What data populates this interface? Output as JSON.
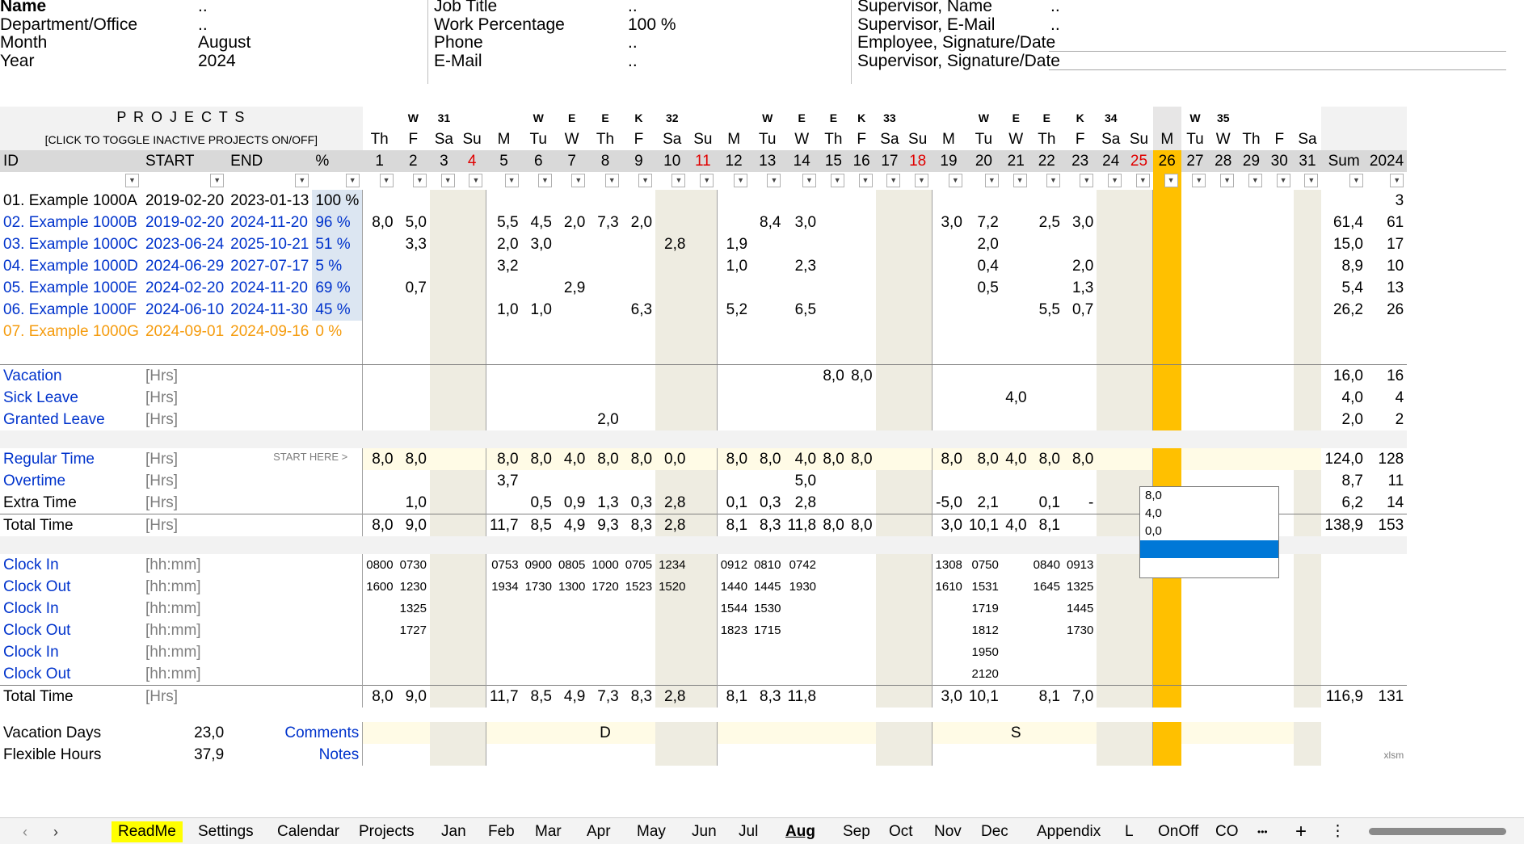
{
  "header": {
    "col1": [
      {
        "label": "Name",
        "value": ".."
      },
      {
        "label": "Department/Office",
        "value": ".."
      },
      {
        "label": "Month",
        "value": "August"
      },
      {
        "label": "Year",
        "value": "2024"
      }
    ],
    "col2": [
      {
        "label": "Job Title",
        "value": ".."
      },
      {
        "label": "Work Percentage",
        "value": "100 %"
      },
      {
        "label": "Phone",
        "value": ".."
      },
      {
        "label": "E-Mail",
        "value": ".."
      }
    ],
    "col3": [
      {
        "label": "Supervisor, Name",
        "value": ".."
      },
      {
        "label": "Supervisor, E-Mail",
        "value": ".."
      },
      {
        "label": "Employee, Signature/Date",
        "value": ""
      },
      {
        "label": "Supervisor, Signature/Date",
        "value": ""
      }
    ]
  },
  "projects_title": "P R O J E C T S",
  "projects_subtitle": "[CLICK TO TOGGLE INACTIVE PROJECTS ON/OFF]",
  "col_headers": {
    "id": "ID",
    "start": "START",
    "end": "END",
    "pct": "%",
    "sum": "Sum",
    "year": "2024"
  },
  "weeks": [
    {
      "letters": [
        "W",
        "31"
      ],
      "span": 4
    },
    {
      "letters": [
        "W",
        "E",
        "E",
        "K",
        "32"
      ],
      "span": 7
    },
    {
      "letters": [
        "W",
        "E",
        "E",
        "K",
        "33"
      ],
      "span": 7
    },
    {
      "letters": [
        "W",
        "E",
        "E",
        "K",
        "34"
      ],
      "span": 7
    },
    {
      "letters": [
        "W",
        "35"
      ],
      "span": 6
    }
  ],
  "days": [
    {
      "d": "1",
      "wd": "Th"
    },
    {
      "d": "2",
      "wd": "F"
    },
    {
      "d": "3",
      "wd": "Sa"
    },
    {
      "d": "4",
      "wd": "Su"
    },
    {
      "d": "5",
      "wd": "M"
    },
    {
      "d": "6",
      "wd": "Tu"
    },
    {
      "d": "7",
      "wd": "W"
    },
    {
      "d": "8",
      "wd": "Th"
    },
    {
      "d": "9",
      "wd": "F"
    },
    {
      "d": "10",
      "wd": "Sa"
    },
    {
      "d": "11",
      "wd": "Su"
    },
    {
      "d": "12",
      "wd": "M"
    },
    {
      "d": "13",
      "wd": "Tu"
    },
    {
      "d": "14",
      "wd": "W"
    },
    {
      "d": "15",
      "wd": "Th"
    },
    {
      "d": "16",
      "wd": "F"
    },
    {
      "d": "17",
      "wd": "Sa"
    },
    {
      "d": "18",
      "wd": "Su"
    },
    {
      "d": "19",
      "wd": "M"
    },
    {
      "d": "20",
      "wd": "Tu"
    },
    {
      "d": "21",
      "wd": "W"
    },
    {
      "d": "22",
      "wd": "Th"
    },
    {
      "d": "23",
      "wd": "F"
    },
    {
      "d": "24",
      "wd": "Sa"
    },
    {
      "d": "25",
      "wd": "Su"
    },
    {
      "d": "26",
      "wd": "M"
    },
    {
      "d": "27",
      "wd": "Tu"
    },
    {
      "d": "28",
      "wd": "W"
    },
    {
      "d": "29",
      "wd": "Th"
    },
    {
      "d": "30",
      "wd": "F"
    },
    {
      "d": "31",
      "wd": "Sa"
    }
  ],
  "projects": [
    {
      "id": "01. Example 1000A",
      "start": "2019-02-20",
      "end": "2023-01-13",
      "pct": "100 %",
      "color": "black",
      "vals": {},
      "sum": "",
      "year": "3"
    },
    {
      "id": "02. Example 1000B",
      "start": "2019-02-20",
      "end": "2024-11-20",
      "pct": "96 %",
      "color": "blue",
      "vals": {
        "1": "8,0",
        "2": "5,0",
        "5": "5,5",
        "6": "4,5",
        "7": "2,0",
        "8": "7,3",
        "9": "2,0",
        "13": "8,4",
        "14": "3,0",
        "19": "3,0",
        "20": "7,2",
        "22": "2,5",
        "23": "3,0"
      },
      "sum": "61,4",
      "year": "61"
    },
    {
      "id": "03. Example 1000C",
      "start": "2023-06-24",
      "end": "2025-10-21",
      "pct": "51 %",
      "color": "blue",
      "vals": {
        "2": "3,3",
        "5": "2,0",
        "6": "3,0",
        "10": "2,8",
        "12": "1,9",
        "20": "2,0"
      },
      "sum": "15,0",
      "year": "17"
    },
    {
      "id": "04. Example 1000D",
      "start": "2024-06-29",
      "end": "2027-07-17",
      "pct": "5 %",
      "color": "blue",
      "vals": {
        "5": "3,2",
        "12": "1,0",
        "14": "2,3",
        "20": "0,4",
        "23": "2,0"
      },
      "sum": "8,9",
      "year": "10"
    },
    {
      "id": "05. Example 1000E",
      "start": "2024-02-20",
      "end": "2024-11-20",
      "pct": "69 %",
      "color": "blue",
      "vals": {
        "2": "0,7",
        "7": "2,9",
        "20": "0,5",
        "23": "1,3"
      },
      "sum": "5,4",
      "year": "13"
    },
    {
      "id": "06. Example 1000F",
      "start": "2024-06-10",
      "end": "2024-11-30",
      "pct": "45 %",
      "color": "blue",
      "vals": {
        "5": "1,0",
        "6": "1,0",
        "9": "6,3",
        "12": "5,2",
        "14": "6,5",
        "22": "5,5",
        "23": "0,7"
      },
      "sum": "26,2",
      "year": "26"
    },
    {
      "id": "07. Example 1000G",
      "start": "2024-09-01",
      "end": "2024-09-16",
      "pct": "0 %",
      "color": "orange",
      "vals": {},
      "sum": "",
      "year": ""
    }
  ],
  "leave": [
    {
      "label": "Vacation",
      "unit": "[Hrs]",
      "vals": {
        "15": "8,0",
        "16": "8,0"
      },
      "sum": "16,0",
      "year": "16"
    },
    {
      "label": "Sick Leave",
      "unit": "[Hrs]",
      "vals": {
        "21": "4,0"
      },
      "sum": "4,0",
      "year": "4"
    },
    {
      "label": "Granted Leave",
      "unit": "[Hrs]",
      "vals": {
        "8": "2,0"
      },
      "sum": "2,0",
      "year": "2"
    }
  ],
  "start_here": "START HERE >",
  "times": [
    {
      "label": "Regular Time",
      "unit": "[Hrs]",
      "color": "blue",
      "vals": {
        "1": "8,0",
        "2": "8,0",
        "5": "8,0",
        "6": "8,0",
        "7": "4,0",
        "8": "8,0",
        "9": "8,0",
        "10": "0,0",
        "12": "8,0",
        "13": "8,0",
        "14": "4,0",
        "15": "8,0",
        "16": "8,0",
        "19": "8,0",
        "20": "8,0",
        "21": "4,0",
        "22": "8,0",
        "23": "8,0"
      },
      "sum": "124,0",
      "year": "128"
    },
    {
      "label": "Overtime",
      "unit": "[Hrs]",
      "color": "blue",
      "vals": {
        "5": "3,7",
        "14": "5,0"
      },
      "sum": "8,7",
      "year": "11"
    },
    {
      "label": "Extra Time",
      "unit": "[Hrs]",
      "color": "black",
      "vals": {
        "2": "1,0",
        "6": "0,5",
        "7": "0,9",
        "8": "1,3",
        "9": "0,3",
        "10": "2,8",
        "12": "0,1",
        "13": "0,3",
        "14": "2,8",
        "19": "-5,0",
        "20": "2,1",
        "22": "0,1",
        "23": "-"
      },
      "sum": "6,2",
      "year": "14"
    },
    {
      "label": "Total Time",
      "unit": "[Hrs]",
      "color": "black",
      "vals": {
        "1": "8,0",
        "2": "9,0",
        "5": "11,7",
        "6": "8,5",
        "7": "4,9",
        "8": "9,3",
        "9": "8,3",
        "10": "2,8",
        "12": "8,1",
        "13": "8,3",
        "14": "11,8",
        "15": "8,0",
        "16": "8,0",
        "19": "3,0",
        "20": "10,1",
        "21": "4,0",
        "22": "8,1"
      },
      "sum": "138,9",
      "year": "153"
    }
  ],
  "clocks": [
    {
      "label": "Clock In",
      "unit": "[hh:mm]",
      "vals": {
        "1": "0800",
        "2": "0730",
        "5": "0753",
        "6": "0900",
        "7": "0805",
        "8": "1000",
        "9": "0705",
        "10": "1234",
        "12": "0912",
        "13": "0810",
        "14": "0742",
        "19": "1308",
        "20": "0750",
        "22": "0840",
        "23": "0913"
      }
    },
    {
      "label": "Clock Out",
      "unit": "[hh:mm]",
      "vals": {
        "1": "1600",
        "2": "1230",
        "5": "1934",
        "6": "1730",
        "7": "1300",
        "8": "1720",
        "9": "1523",
        "10": "1520",
        "12": "1440",
        "13": "1445",
        "14": "1930",
        "19": "1610",
        "20": "1531",
        "22": "1645",
        "23": "1325"
      }
    },
    {
      "label": "Clock In",
      "unit": "[hh:mm]",
      "vals": {
        "2": "1325",
        "12": "1544",
        "13": "1530",
        "20": "1719",
        "23": "1445"
      }
    },
    {
      "label": "Clock Out",
      "unit": "[hh:mm]",
      "vals": {
        "2": "1727",
        "12": "1823",
        "13": "1715",
        "20": "1812",
        "23": "1730"
      }
    },
    {
      "label": "Clock In",
      "unit": "[hh:mm]",
      "vals": {
        "20": "1950"
      }
    },
    {
      "label": "Clock Out",
      "unit": "[hh:mm]",
      "vals": {
        "20": "2120"
      }
    }
  ],
  "clock_total": {
    "label": "Total Time",
    "unit": "[Hrs]",
    "vals": {
      "1": "8,0",
      "2": "9,0",
      "5": "11,7",
      "6": "8,5",
      "7": "4,9",
      "8": "7,3",
      "9": "8,3",
      "10": "2,8",
      "12": "8,1",
      "13": "8,3",
      "14": "11,8",
      "19": "3,0",
      "20": "10,1",
      "22": "8,1",
      "23": "7,0"
    },
    "sum": "116,9",
    "year": "131"
  },
  "summary": [
    {
      "label": "Vacation Days",
      "value": "23,0",
      "link": "Comments",
      "vals": {
        "8": "D",
        "21": "S"
      }
    },
    {
      "label": "Flexible Hours",
      "value": "37,9",
      "link": "Notes",
      "vals": {}
    }
  ],
  "xlsm": "xlsm",
  "dropdown_options": [
    "8,0",
    "4,0",
    "0,0",
    ""
  ],
  "tabs": [
    "ReadMe",
    "Settings",
    "Calendar",
    "Projects",
    "Jan",
    "Feb",
    "Mar",
    "Apr",
    "May",
    "Jun",
    "Jul",
    "Aug",
    "Sep",
    "Oct",
    "Nov",
    "Dec",
    "Appendix",
    "L",
    "OnOff",
    "CO"
  ],
  "active_tab": "Aug",
  "weekend_days": [
    "3",
    "4",
    "10",
    "11",
    "17",
    "18",
    "24",
    "25",
    "31"
  ],
  "red_days": [
    "4",
    "11",
    "18",
    "25"
  ],
  "current_day": "26",
  "colors": {
    "accent": "#ffc000",
    "weekend": "#eeece1",
    "link": "#0033cc",
    "inactive": "#f59b0c",
    "sunday": "#e00000",
    "selected": "#0078d7"
  }
}
